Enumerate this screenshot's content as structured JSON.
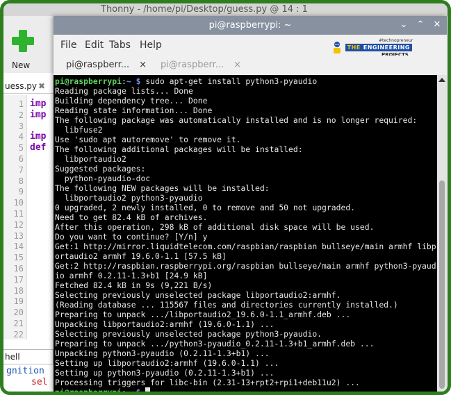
{
  "thonny": {
    "window_title": "Thonny - /home/pi/Desktop/guess.py @ 14 : 1",
    "toolbar": {
      "new_label": "New"
    },
    "editor_tab": {
      "label": "uess.py",
      "close": "✖"
    },
    "line_numbers": [
      "1",
      "2",
      "3",
      "4",
      "5",
      "6",
      "7",
      "8",
      "9",
      "10",
      "11",
      "12",
      "13",
      "14",
      "15",
      "16",
      "17",
      "18",
      "19",
      "20",
      "21",
      "22"
    ],
    "code_fragments": [
      {
        "line": 1,
        "text": "imp"
      },
      {
        "line": 2,
        "text": "imp"
      },
      {
        "line": 4,
        "text": "imp"
      },
      {
        "line": 5,
        "text": "def"
      }
    ],
    "shell_tab": {
      "label": "hell"
    },
    "shell_lines": {
      "blue": "gnition",
      "red": "sel"
    }
  },
  "terminal": {
    "title": "pi@raspberrypi: ~",
    "window_buttons": {
      "minimize": "⌄",
      "maximize": "⌃",
      "close": "✕"
    },
    "menu": [
      "File",
      "Edit",
      "Tabs",
      "Help"
    ],
    "tabs": [
      {
        "label": "pi@raspberr...",
        "close": "×",
        "active": true
      },
      {
        "label": "pi@raspberr...",
        "close": "×",
        "active": false
      }
    ],
    "prompt": {
      "user_host": "pi@raspberrypi",
      "sep": ":",
      "path": "~ $"
    },
    "command": "sudo apt-get install python3-pyaudio",
    "output": [
      "Reading package lists... Done",
      "Building dependency tree... Done",
      "Reading state information... Done",
      "The following package was automatically installed and is no longer required:",
      "  libfuse2",
      "Use 'sudo apt autoremove' to remove it.",
      "The following additional packages will be installed:",
      "  libportaudio2",
      "Suggested packages:",
      "  python-pyaudio-doc",
      "The following NEW packages will be installed:",
      "  libportaudio2 python3-pyaudio",
      "0 upgraded, 2 newly installed, 0 to remove and 50 not upgraded.",
      "Need to get 82.4 kB of archives.",
      "After this operation, 298 kB of additional disk space will be used.",
      "Do you want to continue? [Y/n] y",
      "Get:1 http://mirror.liquidtelecom.com/raspbian/raspbian bullseye/main armhf libp",
      "ortaudio2 armhf 19.6.0-1.1 [57.5 kB]",
      "Get:2 http://raspbian.raspberrypi.org/raspbian bullseye/main armhf python3-pyaud",
      "io armhf 0.2.11-1.3+b1 [24.9 kB]",
      "Fetched 82.4 kB in 9s (9,221 B/s)",
      "Selecting previously unselected package libportaudio2:armhf.",
      "(Reading database ... 115567 files and directories currently installed.)",
      "Preparing to unpack .../libportaudio2_19.6.0-1.1_armhf.deb ...",
      "Unpacking libportaudio2:armhf (19.6.0-1.1) ...",
      "Selecting previously unselected package python3-pyaudio.",
      "Preparing to unpack .../python3-pyaudio_0.2.11-1.3+b1_armhf.deb ...",
      "Unpacking python3-pyaudio (0.2.11-1.3+b1) ...",
      "Setting up libportaudio2:armhf (19.6.0-1.1) ...",
      "Setting up python3-pyaudio (0.2.11-1.3+b1) ...",
      "Processing triggers for libc-bin (2.31-13+rpt2+rpi1+deb11u2) ..."
    ]
  },
  "watermark": {
    "top": "#technopreneur",
    "the": "THE",
    "main": "ENGINEERING",
    "sub": "PROJECTS"
  },
  "colors": {
    "frame_border": "#2e7d1e",
    "prompt_green": "#5fd35f",
    "path_blue": "#6d8fe8",
    "titlebar": "#87919f"
  }
}
